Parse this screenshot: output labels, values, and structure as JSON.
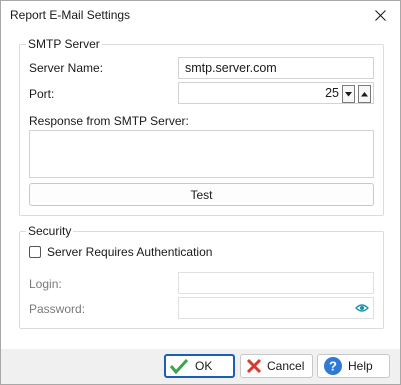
{
  "window": {
    "title": "Report E-Mail Settings"
  },
  "smtp": {
    "group_title": "SMTP Server",
    "server_name_label": "Server Name:",
    "server_name_value": "smtp.server.com",
    "port_label": "Port:",
    "port_value": "25",
    "response_label": "Response from SMTP Server:",
    "response_value": "",
    "test_button": "Test"
  },
  "security": {
    "group_title": "Security",
    "auth_checkbox_label": "Server Requires Authentication",
    "auth_checked": false,
    "login_label": "Login:",
    "login_value": "",
    "password_label": "Password:",
    "password_value": ""
  },
  "footer": {
    "ok_label": "OK",
    "cancel_label": "Cancel",
    "help_label": "Help"
  },
  "colors": {
    "accent": "#1a5fb4",
    "ok_check": "#3aa64a",
    "cancel_x": "#d93a2b",
    "help_icon": "#2f7ad6",
    "eye_icon": "#1a8fb0"
  }
}
